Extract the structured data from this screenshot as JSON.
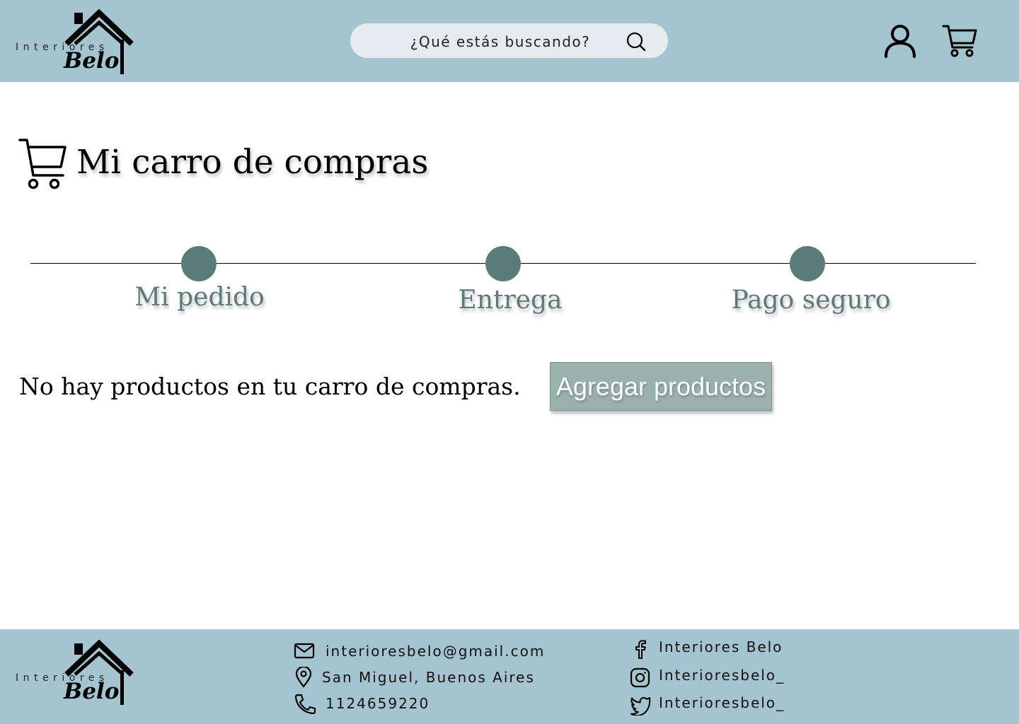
{
  "header": {
    "logo": {
      "word": "Interiores",
      "name": "Belo"
    },
    "search": {
      "placeholder": "¿Qué estás buscando?",
      "icon": "search-icon"
    },
    "icons": [
      "user-icon",
      "cart-icon"
    ]
  },
  "main": {
    "title": "Mi carro de compras",
    "title_icon": "cart-icon",
    "steps": [
      {
        "label": "Mi pedido"
      },
      {
        "label": "Entrega"
      },
      {
        "label": "Pago seguro"
      }
    ],
    "empty_message": "No hay productos en tu carro de compras.",
    "add_button_label": "Agregar productos"
  },
  "footer": {
    "logo": {
      "word": "Interiores",
      "name": "Belo"
    },
    "contact": {
      "email": "interioresbelo@gmail.com",
      "address": "San Miguel, Buenos Aires",
      "phone": "1124659220"
    },
    "social": {
      "facebook": "Interiores Belo",
      "instagram": "Interioresbelo_",
      "twitter": "Interioresbelo_"
    }
  },
  "colors": {
    "header_bg": "#a4c5cf",
    "footer_bg": "#a4c5cf",
    "accent": "#5b7a7a",
    "button_bg": "#9ab1ac",
    "search_bg": "#e4ecef"
  }
}
